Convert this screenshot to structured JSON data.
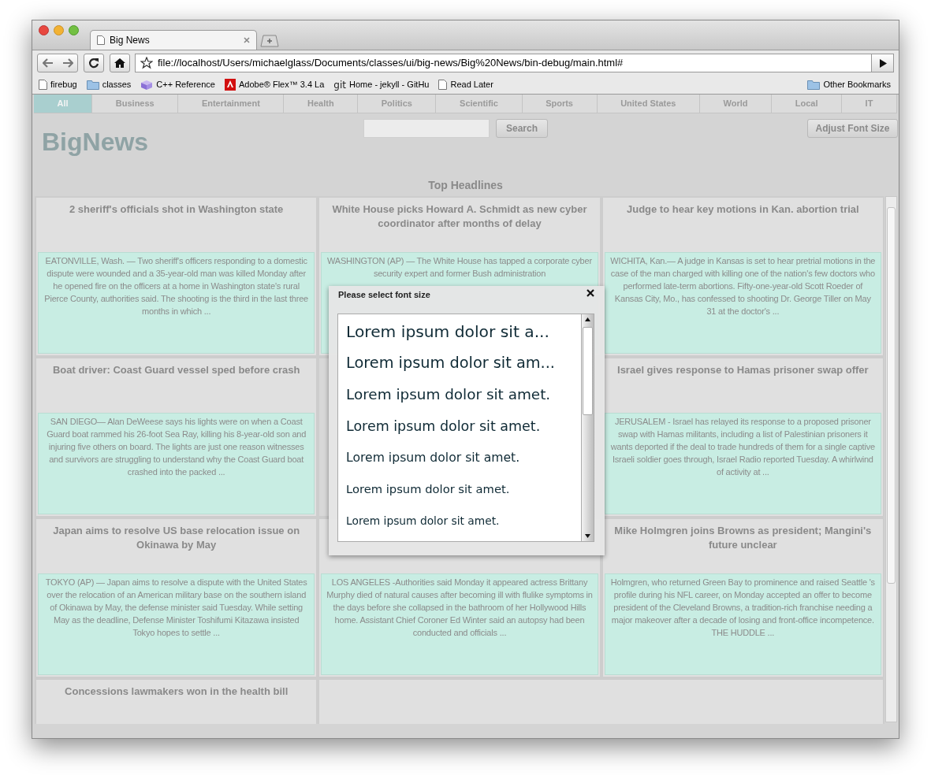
{
  "browser": {
    "tab_title": "Big News",
    "url": "file://localhost/Users/michaelglass/Documents/classes/ui/big-news/Big%20News/bin-debug/main.html#",
    "bookmarks": [
      {
        "kind": "page",
        "label": "firebug"
      },
      {
        "kind": "folder",
        "label": "classes"
      },
      {
        "kind": "cube",
        "label": "C++ Reference"
      },
      {
        "kind": "adobe",
        "label": "Adobe® Flex™ 3.4 La"
      },
      {
        "kind": "git",
        "badge": "git",
        "label": "Home - jekyll - GitHu"
      },
      {
        "kind": "page",
        "label": "Read Later"
      }
    ],
    "other_bookmarks": "Other Bookmarks"
  },
  "categories": [
    {
      "label": "All",
      "selected": true
    },
    {
      "label": "Business",
      "selected": false
    },
    {
      "label": "Entertainment",
      "selected": false
    },
    {
      "label": "Health",
      "selected": false
    },
    {
      "label": "Politics",
      "selected": false
    },
    {
      "label": "Scientific",
      "selected": false
    },
    {
      "label": "Sports",
      "selected": false
    },
    {
      "label": "United States",
      "selected": false
    },
    {
      "label": "World",
      "selected": false
    },
    {
      "label": "Local",
      "selected": false
    },
    {
      "label": "IT",
      "selected": false
    }
  ],
  "logo": "BigNews",
  "search_button": "Search",
  "adjust_font_button": "Adjust Font Size",
  "section_title": "Top Headlines",
  "articles": [
    {
      "title": "2 sheriff's officials shot in Washington state",
      "summary": "EATONVILLE, Wash. — Two sheriff's officers responding to a domestic dispute were wounded and a 35-year-old man was killed Monday after he opened fire on the officers at a home in Washington state's rural Pierce County, authorities said. The shooting is the third in the last three months in which ..."
    },
    {
      "title": "White House picks Howard A. Schmidt as new cyber coordinator after months of delay",
      "summary": "WASHINGTON (AP) — The White House has tapped a corporate cyber security expert and former Bush administration"
    },
    {
      "title": "Judge to hear key motions in Kan. abortion trial",
      "summary": "WICHITA, Kan.— A judge in Kansas is set to hear pretrial motions in the case of the man charged with killing one of the nation's few doctors who performed late-term abortions. Fifty-one-year-old Scott Roeder of Kansas City, Mo., has confessed to shooting Dr. George Tiller on May 31 at the doctor's ..."
    },
    {
      "title": "Boat driver: Coast Guard vessel sped before crash",
      "summary": "SAN DIEGO— Alan DeWeese says his lights were on when a Coast Guard boat rammed his 26-foot Sea Ray, killing his 8-year-old son and injuring five others on board. The lights are just one reason witnesses and survivors are struggling to understand why the Coast Guard boat crashed into the packed ..."
    },
    {
      "kind": "covered"
    },
    {
      "title": "Israel gives response to Hamas prisoner swap offer",
      "summary": "JERUSALEM - Israel has relayed its response to a proposed prisoner swap with Hamas militants, including a list of Palestinian prisoners it wants deported if the deal to trade hundreds of them for a single captive Israeli soldier goes through, Israel Radio reported Tuesday. A whirlwind of activity at ..."
    },
    {
      "title": "Japan aims to resolve US base relocation issue on Okinawa by May",
      "summary": "TOKYO (AP) — Japan aims to resolve a dispute with the United States over the relocation of an American military base on the southern island of Okinawa by May, the defense minister said Tuesday. While setting May as the deadline, Defense Minister Toshifumi Kitazawa insisted Tokyo hopes to settle ..."
    },
    {
      "summary": "LOS ANGELES -Authorities said Monday it appeared actress Brittany Murphy died of natural causes after becoming ill with flulike symptoms in the days before she collapsed in the bathroom of her Hollywood Hills home. Assistant Chief Coroner Ed Winter said an autopsy had been conducted and officials ..."
    },
    {
      "title": "Mike Holmgren joins Browns as president; Mangini's future unclear",
      "summary": "Holmgren, who returned Green Bay to prominence and raised Seattle 's profile during his NFL career, on Monday accepted an offer to become president of the Cleveland Browns, a tradition-rich franchise needing a major makeover after a decade of losing and front-office incompetence. THE HUDDLE ..."
    },
    {
      "title": "Concessions lawmakers won in the health bill"
    }
  ],
  "dialog": {
    "title": "Please select font size",
    "options": [
      {
        "label": "Lorem ipsum dolor sit a..."
      },
      {
        "label": "Lorem ipsum dolor sit am..."
      },
      {
        "label": "Lorem ipsum dolor sit amet."
      },
      {
        "label": "Lorem ipsum dolor sit amet."
      },
      {
        "label": "Lorem ipsum dolor sit amet."
      },
      {
        "label": "Lorem ipsum dolor sit amet."
      },
      {
        "label": "Lorem ipsum dolor sit amet."
      }
    ]
  }
}
